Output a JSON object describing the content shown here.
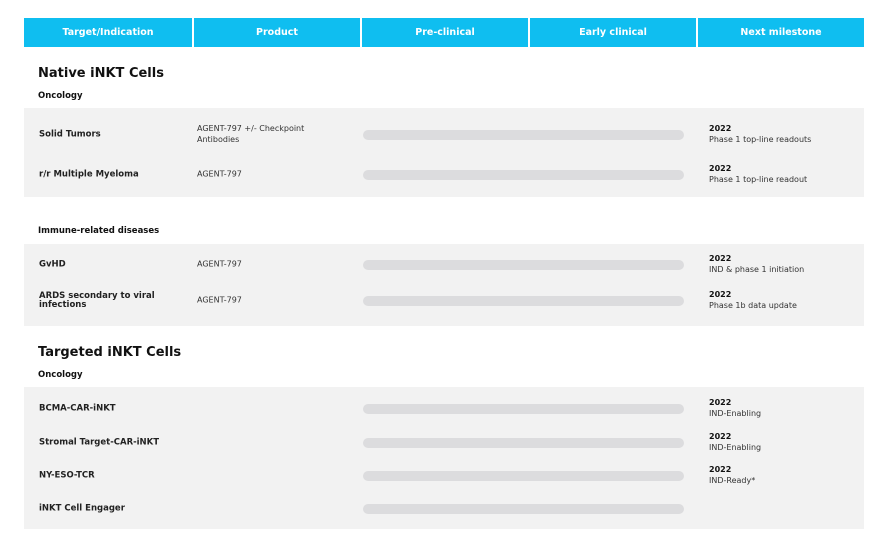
{
  "colors": {
    "header_bg": "#0fbef0",
    "panel_bg": "#f2f2f2",
    "bar_track": "#dcdcde",
    "bar_fill": "#0fbef0"
  },
  "header": {
    "col1": "Target/Indication",
    "col2": "Product",
    "col3": "Pre-clinical",
    "col4": "Early clinical",
    "col5": "Next milestone"
  },
  "sections": [
    {
      "title": "Native iNKT Cells",
      "groups": [
        {
          "label": "Oncology",
          "rows": [
            {
              "target": "Solid Tumors",
              "product": "AGENT-797 +/- Checkpoint Antibodies",
              "progress": 0,
              "year": "2022",
              "milestone": "Phase 1 top-line readouts"
            },
            {
              "target": "r/r Multiple Myeloma",
              "product": "AGENT-797",
              "progress": 0,
              "year": "2022",
              "milestone": "Phase 1 top-line readout"
            }
          ]
        },
        {
          "label": "Immune-related diseases",
          "rows": [
            {
              "target": "GvHD",
              "product": "AGENT-797",
              "progress": 0,
              "year": "2022",
              "milestone": "IND & phase 1 initiation"
            },
            {
              "target": "ARDS secondary to viral infections",
              "product": "AGENT-797",
              "progress": 0,
              "year": "2022",
              "milestone": "Phase 1b data update"
            }
          ]
        }
      ]
    },
    {
      "title": "Targeted iNKT Cells",
      "groups": [
        {
          "label": "Oncology",
          "rows": [
            {
              "target": "BCMA-CAR-iNKT",
              "product": "",
              "progress": 0,
              "year": "2022",
              "milestone": "IND-Enabling"
            },
            {
              "target": "Stromal Target-CAR-iNKT",
              "product": "",
              "progress": 0,
              "year": "2022",
              "milestone": "IND-Enabling"
            },
            {
              "target": "NY-ESO-TCR",
              "product": "",
              "progress": 0,
              "year": "2022",
              "milestone": "IND-Ready*"
            },
            {
              "target": "iNKT Cell Engager",
              "product": "",
              "progress": 0,
              "year": "",
              "milestone": ""
            }
          ]
        }
      ]
    }
  ]
}
